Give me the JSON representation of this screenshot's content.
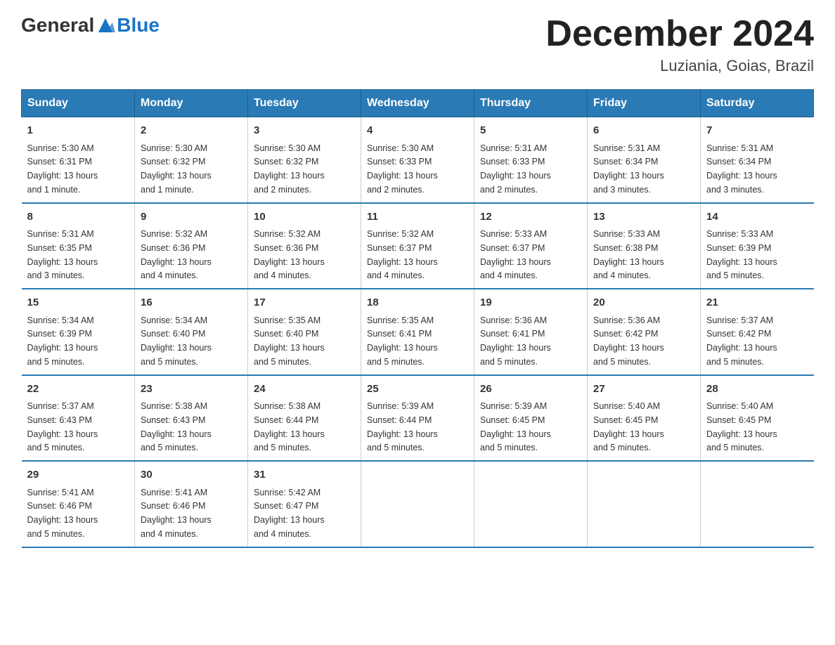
{
  "header": {
    "logo_general": "General",
    "logo_blue": "Blue",
    "title": "December 2024",
    "subtitle": "Luziania, Goias, Brazil"
  },
  "days_of_week": [
    "Sunday",
    "Monday",
    "Tuesday",
    "Wednesday",
    "Thursday",
    "Friday",
    "Saturday"
  ],
  "weeks": [
    [
      {
        "day": "1",
        "sunrise": "5:30 AM",
        "sunset": "6:31 PM",
        "daylight": "13 hours and 1 minute."
      },
      {
        "day": "2",
        "sunrise": "5:30 AM",
        "sunset": "6:32 PM",
        "daylight": "13 hours and 1 minute."
      },
      {
        "day": "3",
        "sunrise": "5:30 AM",
        "sunset": "6:32 PM",
        "daylight": "13 hours and 2 minutes."
      },
      {
        "day": "4",
        "sunrise": "5:30 AM",
        "sunset": "6:33 PM",
        "daylight": "13 hours and 2 minutes."
      },
      {
        "day": "5",
        "sunrise": "5:31 AM",
        "sunset": "6:33 PM",
        "daylight": "13 hours and 2 minutes."
      },
      {
        "day": "6",
        "sunrise": "5:31 AM",
        "sunset": "6:34 PM",
        "daylight": "13 hours and 3 minutes."
      },
      {
        "day": "7",
        "sunrise": "5:31 AM",
        "sunset": "6:34 PM",
        "daylight": "13 hours and 3 minutes."
      }
    ],
    [
      {
        "day": "8",
        "sunrise": "5:31 AM",
        "sunset": "6:35 PM",
        "daylight": "13 hours and 3 minutes."
      },
      {
        "day": "9",
        "sunrise": "5:32 AM",
        "sunset": "6:36 PM",
        "daylight": "13 hours and 4 minutes."
      },
      {
        "day": "10",
        "sunrise": "5:32 AM",
        "sunset": "6:36 PM",
        "daylight": "13 hours and 4 minutes."
      },
      {
        "day": "11",
        "sunrise": "5:32 AM",
        "sunset": "6:37 PM",
        "daylight": "13 hours and 4 minutes."
      },
      {
        "day": "12",
        "sunrise": "5:33 AM",
        "sunset": "6:37 PM",
        "daylight": "13 hours and 4 minutes."
      },
      {
        "day": "13",
        "sunrise": "5:33 AM",
        "sunset": "6:38 PM",
        "daylight": "13 hours and 4 minutes."
      },
      {
        "day": "14",
        "sunrise": "5:33 AM",
        "sunset": "6:39 PM",
        "daylight": "13 hours and 5 minutes."
      }
    ],
    [
      {
        "day": "15",
        "sunrise": "5:34 AM",
        "sunset": "6:39 PM",
        "daylight": "13 hours and 5 minutes."
      },
      {
        "day": "16",
        "sunrise": "5:34 AM",
        "sunset": "6:40 PM",
        "daylight": "13 hours and 5 minutes."
      },
      {
        "day": "17",
        "sunrise": "5:35 AM",
        "sunset": "6:40 PM",
        "daylight": "13 hours and 5 minutes."
      },
      {
        "day": "18",
        "sunrise": "5:35 AM",
        "sunset": "6:41 PM",
        "daylight": "13 hours and 5 minutes."
      },
      {
        "day": "19",
        "sunrise": "5:36 AM",
        "sunset": "6:41 PM",
        "daylight": "13 hours and 5 minutes."
      },
      {
        "day": "20",
        "sunrise": "5:36 AM",
        "sunset": "6:42 PM",
        "daylight": "13 hours and 5 minutes."
      },
      {
        "day": "21",
        "sunrise": "5:37 AM",
        "sunset": "6:42 PM",
        "daylight": "13 hours and 5 minutes."
      }
    ],
    [
      {
        "day": "22",
        "sunrise": "5:37 AM",
        "sunset": "6:43 PM",
        "daylight": "13 hours and 5 minutes."
      },
      {
        "day": "23",
        "sunrise": "5:38 AM",
        "sunset": "6:43 PM",
        "daylight": "13 hours and 5 minutes."
      },
      {
        "day": "24",
        "sunrise": "5:38 AM",
        "sunset": "6:44 PM",
        "daylight": "13 hours and 5 minutes."
      },
      {
        "day": "25",
        "sunrise": "5:39 AM",
        "sunset": "6:44 PM",
        "daylight": "13 hours and 5 minutes."
      },
      {
        "day": "26",
        "sunrise": "5:39 AM",
        "sunset": "6:45 PM",
        "daylight": "13 hours and 5 minutes."
      },
      {
        "day": "27",
        "sunrise": "5:40 AM",
        "sunset": "6:45 PM",
        "daylight": "13 hours and 5 minutes."
      },
      {
        "day": "28",
        "sunrise": "5:40 AM",
        "sunset": "6:45 PM",
        "daylight": "13 hours and 5 minutes."
      }
    ],
    [
      {
        "day": "29",
        "sunrise": "5:41 AM",
        "sunset": "6:46 PM",
        "daylight": "13 hours and 5 minutes."
      },
      {
        "day": "30",
        "sunrise": "5:41 AM",
        "sunset": "6:46 PM",
        "daylight": "13 hours and 4 minutes."
      },
      {
        "day": "31",
        "sunrise": "5:42 AM",
        "sunset": "6:47 PM",
        "daylight": "13 hours and 4 minutes."
      },
      {
        "day": "",
        "sunrise": "",
        "sunset": "",
        "daylight": ""
      },
      {
        "day": "",
        "sunrise": "",
        "sunset": "",
        "daylight": ""
      },
      {
        "day": "",
        "sunrise": "",
        "sunset": "",
        "daylight": ""
      },
      {
        "day": "",
        "sunrise": "",
        "sunset": "",
        "daylight": ""
      }
    ]
  ],
  "labels": {
    "sunrise": "Sunrise:",
    "sunset": "Sunset:",
    "daylight": "Daylight:"
  }
}
